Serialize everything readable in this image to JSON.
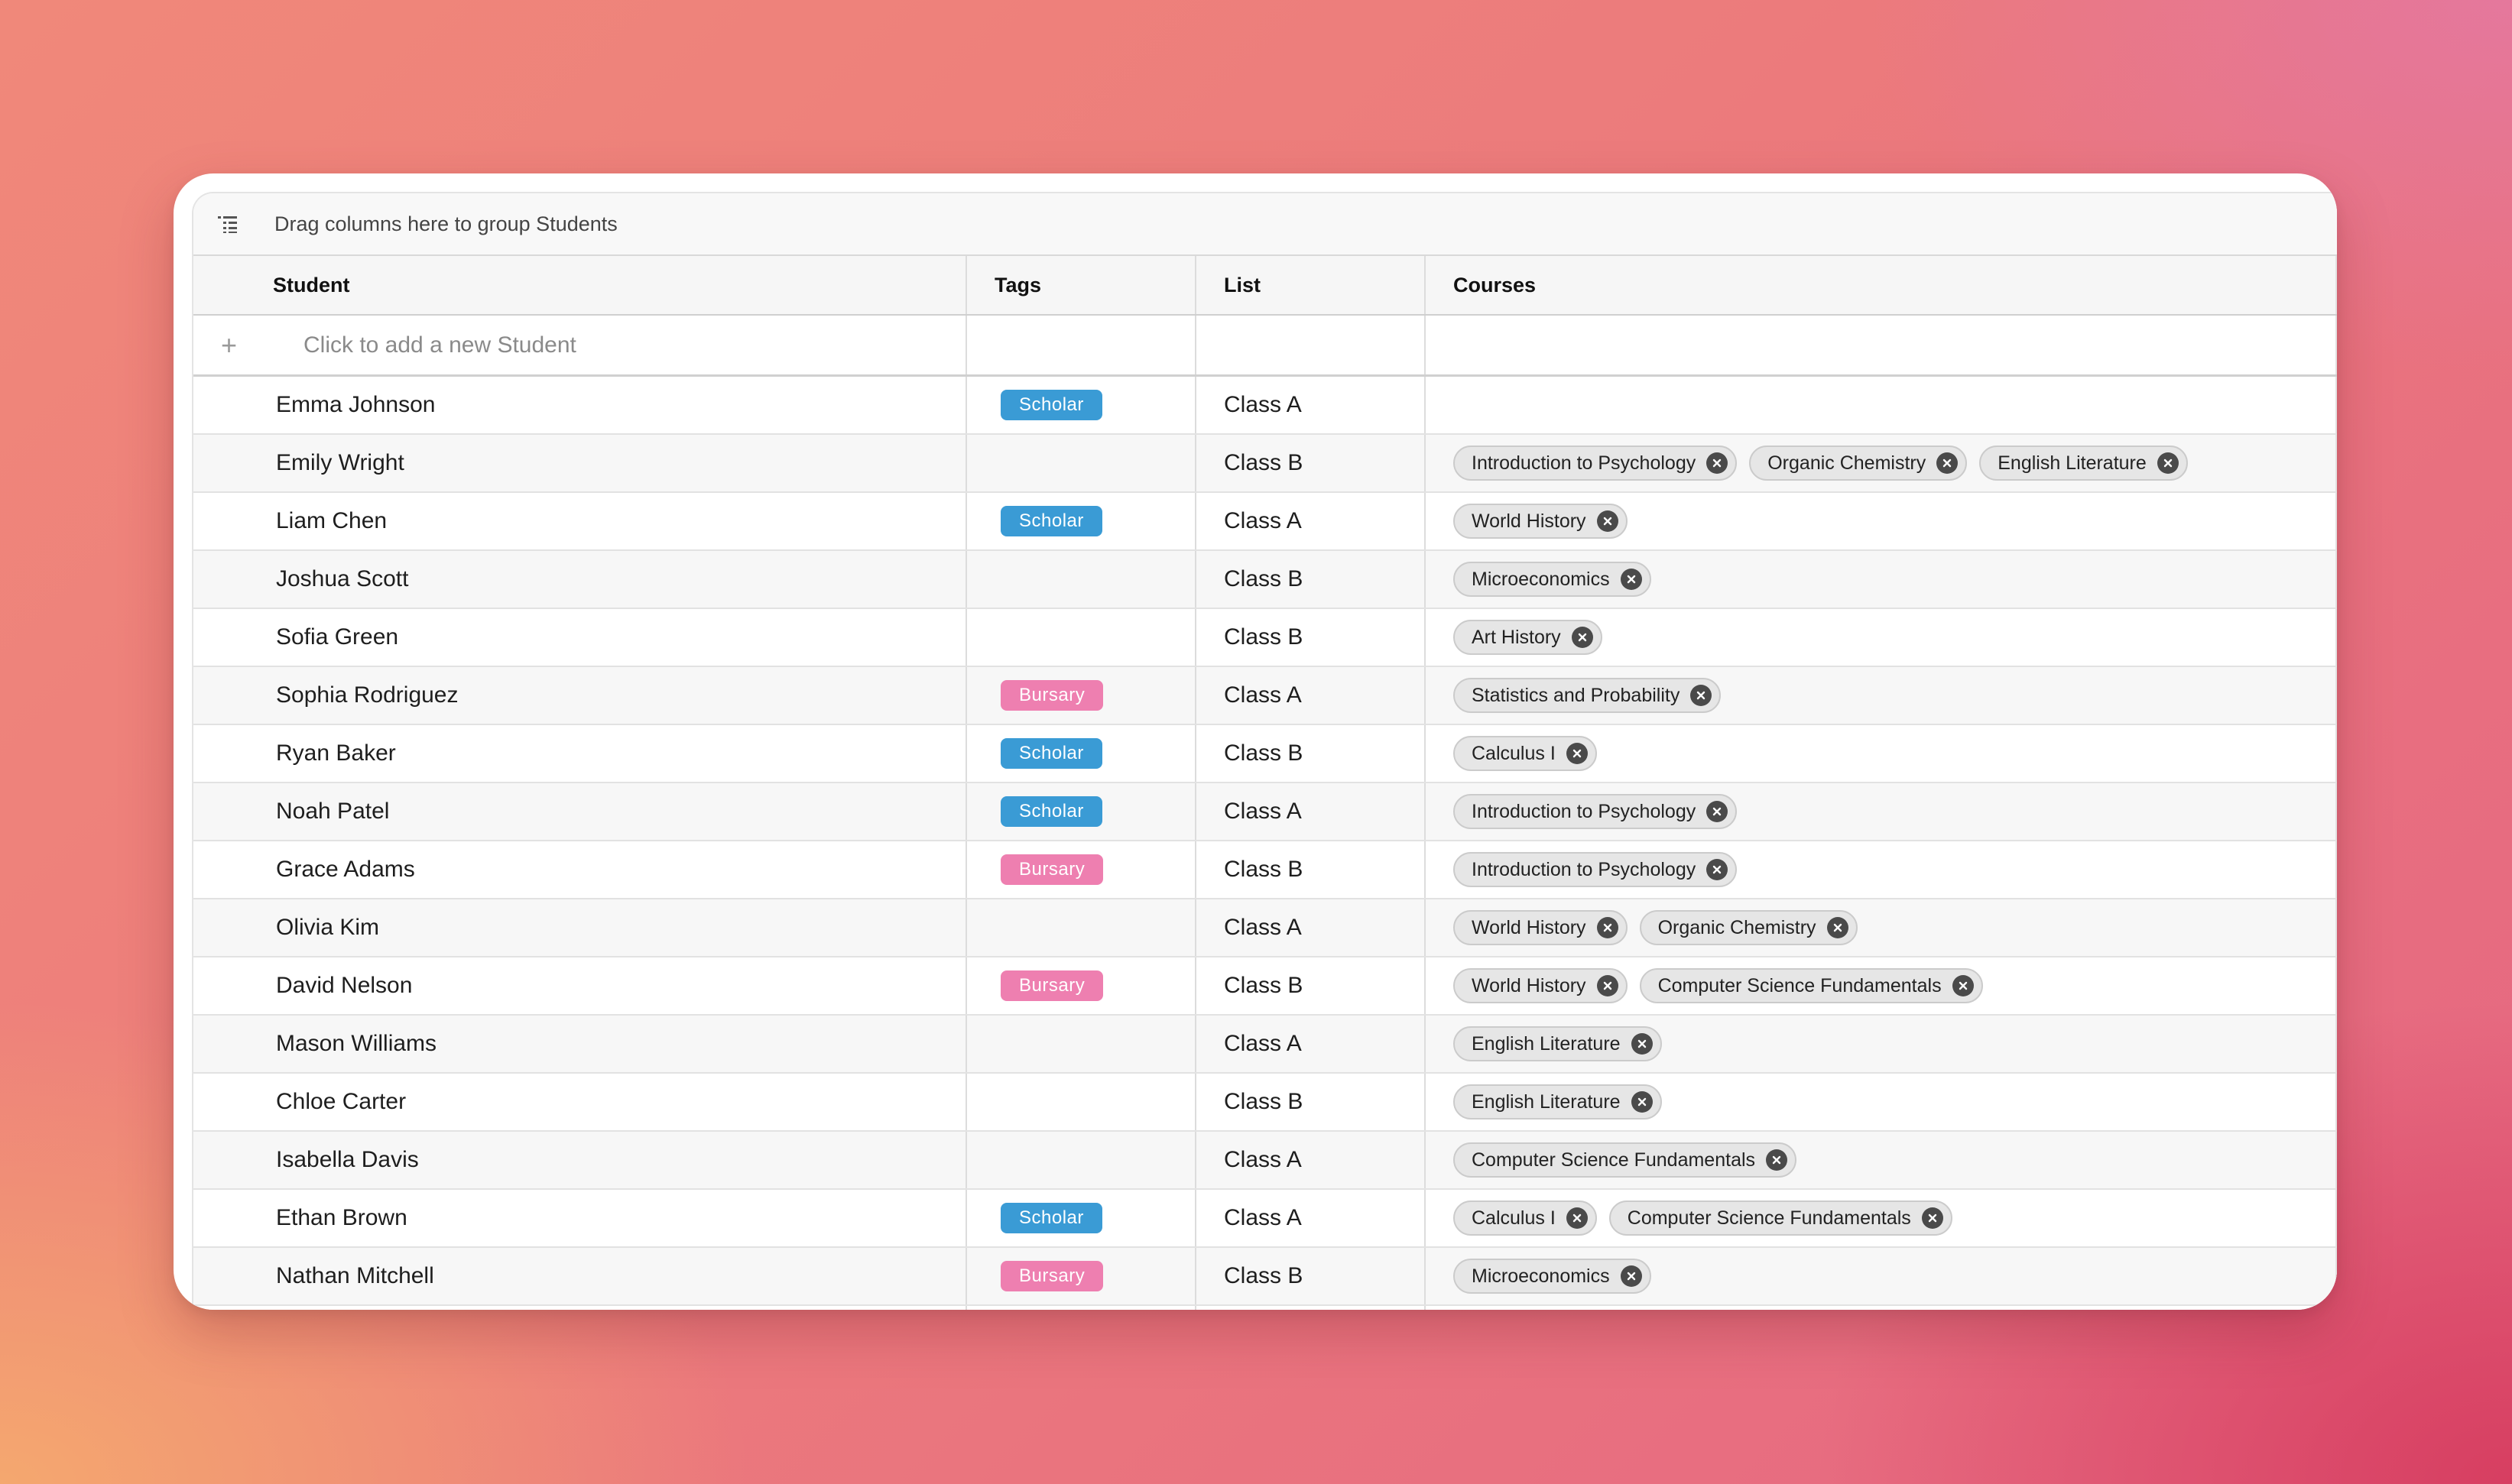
{
  "group_bar": {
    "text": "Drag columns here to group Students"
  },
  "columns": {
    "student": "Student",
    "tags": "Tags",
    "list": "List",
    "courses": "Courses"
  },
  "add_row": {
    "plus": "+",
    "placeholder": "Click to add a new Student"
  },
  "colors": {
    "scholar": "#3a9bd5",
    "bursary": "#ee7fb0"
  },
  "rows": [
    {
      "student": "Emma Johnson",
      "tag": "Scholar",
      "list": "Class A",
      "courses": []
    },
    {
      "student": "Emily Wright",
      "tag": "",
      "list": "Class B",
      "courses": [
        "Introduction to Psychology",
        "Organic Chemistry",
        "English Literature"
      ]
    },
    {
      "student": "Liam Chen",
      "tag": "Scholar",
      "list": "Class A",
      "courses": [
        "World History"
      ]
    },
    {
      "student": "Joshua Scott",
      "tag": "",
      "list": "Class B",
      "courses": [
        "Microeconomics"
      ]
    },
    {
      "student": "Sofia Green",
      "tag": "",
      "list": "Class B",
      "courses": [
        "Art History"
      ]
    },
    {
      "student": "Sophia Rodriguez",
      "tag": "Bursary",
      "list": "Class A",
      "courses": [
        "Statistics and Probability"
      ]
    },
    {
      "student": "Ryan Baker",
      "tag": "Scholar",
      "list": "Class B",
      "courses": [
        "Calculus I"
      ]
    },
    {
      "student": "Noah Patel",
      "tag": "Scholar",
      "list": "Class A",
      "courses": [
        "Introduction to Psychology"
      ]
    },
    {
      "student": "Grace Adams",
      "tag": "Bursary",
      "list": "Class B",
      "courses": [
        "Introduction to Psychology"
      ]
    },
    {
      "student": "Olivia Kim",
      "tag": "",
      "list": "Class A",
      "courses": [
        "World History",
        "Organic Chemistry"
      ]
    },
    {
      "student": "David Nelson",
      "tag": "Bursary",
      "list": "Class B",
      "courses": [
        "World History",
        "Computer Science Fundamentals"
      ]
    },
    {
      "student": "Mason Williams",
      "tag": "",
      "list": "Class A",
      "courses": [
        "English Literature"
      ]
    },
    {
      "student": "Chloe Carter",
      "tag": "",
      "list": "Class B",
      "courses": [
        "English Literature"
      ]
    },
    {
      "student": "Isabella Davis",
      "tag": "",
      "list": "Class A",
      "courses": [
        "Computer Science Fundamentals"
      ]
    },
    {
      "student": "Ethan Brown",
      "tag": "Scholar",
      "list": "Class A",
      "courses": [
        "Calculus I",
        "Computer Science Fundamentals"
      ]
    },
    {
      "student": "Nathan Mitchell",
      "tag": "Bursary",
      "list": "Class B",
      "courses": [
        "Microeconomics"
      ]
    },
    {
      "student": "",
      "tag": "",
      "list": "",
      "courses": []
    }
  ]
}
